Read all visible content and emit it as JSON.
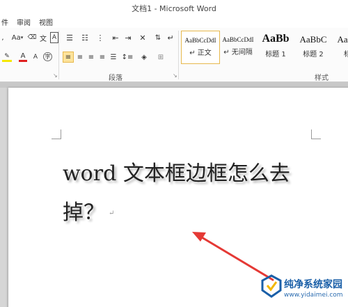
{
  "window": {
    "title": "文档1 - Microsoft Word"
  },
  "menu": {
    "items": [
      "件",
      "审阅",
      "视图"
    ]
  },
  "ribbon": {
    "paragraph_group_label": "段落",
    "styles_group_label": "样式",
    "font_row": {
      "change_case": "Aa",
      "font_color_letter": "A",
      "highlight_letter": "ab",
      "char_border": "A",
      "phonetic": "文",
      "char_shading": "A"
    },
    "styles": [
      {
        "preview": "AaBbCcDdI",
        "name": "↵ 正文",
        "selected": true
      },
      {
        "preview": "AaBbCcDdI",
        "name": "↵ 无间隔",
        "selected": false
      },
      {
        "preview": "AaBb",
        "name": "标题 1",
        "selected": false
      },
      {
        "preview": "AaBbC",
        "name": "标题 2",
        "selected": false
      },
      {
        "preview": "AaBbC",
        "name": "标题",
        "selected": false
      }
    ]
  },
  "document": {
    "line1": "word 文本框边框怎么去",
    "line2": "掉？",
    "paragraph_mark": "↵"
  },
  "watermark": {
    "title": "纯净系统家园",
    "url": "www.yidaimei.com"
  },
  "colors": {
    "arrow": "#e53935",
    "selected_style": "#e7b84c",
    "active_button": "#fde39b",
    "font_color_bar": "#e02020",
    "highlight_bar": "#f5e800",
    "watermark": "#1a5fa8"
  }
}
